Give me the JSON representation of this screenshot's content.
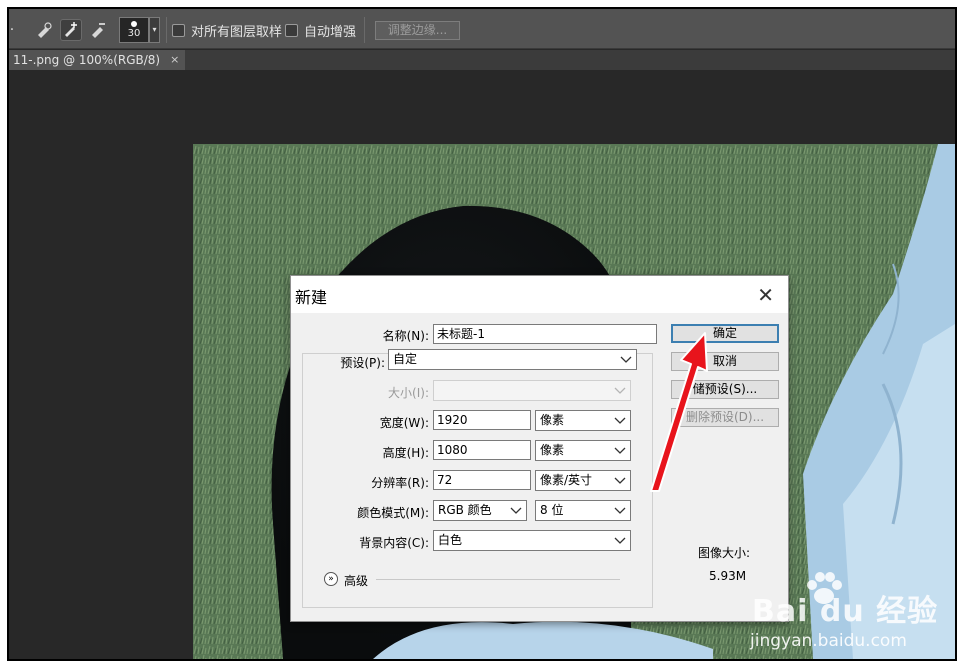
{
  "options_bar": {
    "brush_size": "30",
    "sample_all_layers_label": "对所有图层取样",
    "auto_enhance_label": "自动增强",
    "refine_edge_label": "调整边缘..."
  },
  "document_tab": {
    "title": "11-.png @ 100%(RGB/8)",
    "close": "×"
  },
  "dialog": {
    "title": "新建",
    "close": "✕",
    "name_label": "名称(N):",
    "name_value": "未标题-1",
    "preset_label": "预设(P):",
    "preset_value": "自定",
    "size_label": "大小(I):",
    "width_label": "宽度(W):",
    "width_value": "1920",
    "width_unit": "像素",
    "height_label": "高度(H):",
    "height_value": "1080",
    "height_unit": "像素",
    "resolution_label": "分辨率(R):",
    "resolution_value": "72",
    "resolution_unit": "像素/英寸",
    "color_mode_label": "颜色模式(M):",
    "color_mode_value": "RGB 颜色",
    "bit_depth_value": "8 位",
    "background_label": "背景内容(C):",
    "background_value": "白色",
    "advanced_label": "高级",
    "ok_button": "确定",
    "cancel_button": "取消",
    "save_preset_button": "储预设(S)...",
    "delete_preset_button": "删除预设(D)...",
    "image_size_label": "图像大小:",
    "image_size_value": "5.93M"
  },
  "watermark": {
    "brand": "Bai du 经验",
    "url": "jingyan.baidu.com"
  },
  "colors": {
    "annotation_arrow": "#e8141c",
    "default_button_border": "#3c7fb1"
  }
}
